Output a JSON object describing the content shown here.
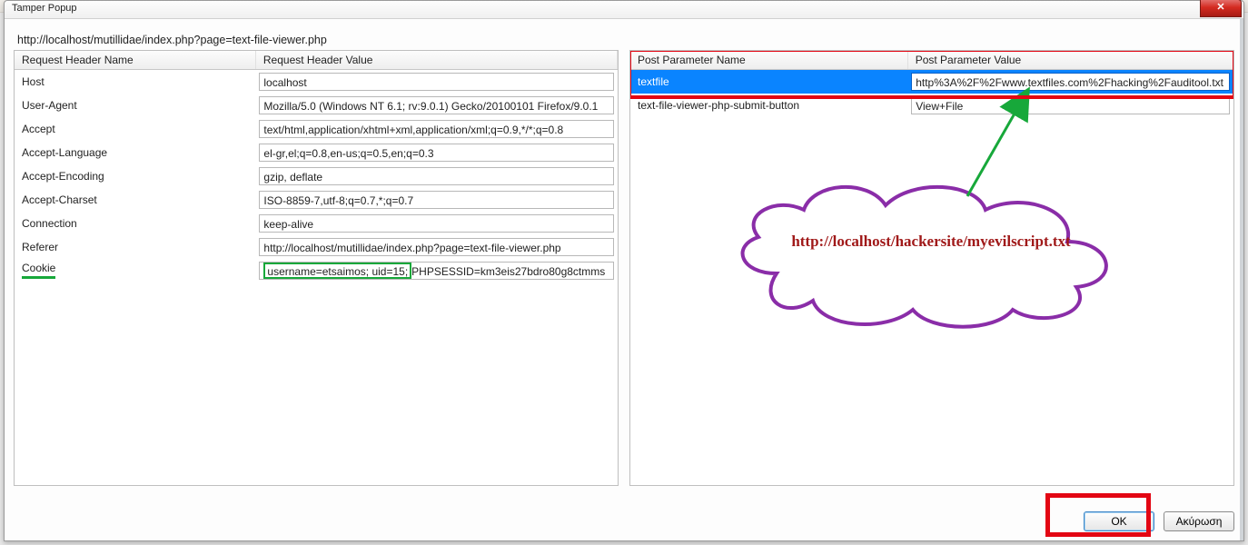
{
  "window": {
    "title": "Tamper Popup",
    "close_label": "✕"
  },
  "url": "http://localhost/mutillidae/index.php?page=text-file-viewer.php",
  "headers_table": {
    "col_name": "Request Header Name",
    "col_value": "Request Header Value",
    "rows": [
      {
        "name": "Host",
        "value": "localhost"
      },
      {
        "name": "User-Agent",
        "value": "Mozilla/5.0 (Windows NT 6.1; rv:9.0.1) Gecko/20100101 Firefox/9.0.1"
      },
      {
        "name": "Accept",
        "value": "text/html,application/xhtml+xml,application/xml;q=0.9,*/*;q=0.8"
      },
      {
        "name": "Accept-Language",
        "value": "el-gr,el;q=0.8,en-us;q=0.5,en;q=0.3"
      },
      {
        "name": "Accept-Encoding",
        "value": "gzip, deflate"
      },
      {
        "name": "Accept-Charset",
        "value": "ISO-8859-7,utf-8;q=0.7,*;q=0.7"
      },
      {
        "name": "Connection",
        "value": "keep-alive"
      },
      {
        "name": "Referer",
        "value": "http://localhost/mutillidae/index.php?page=text-file-viewer.php"
      }
    ],
    "cookie_row": {
      "name": "Cookie",
      "value_highlighted": "username=etsaimos; uid=15;",
      "value_rest": " PHPSESSID=km3eis27bdro80g8ctmms"
    }
  },
  "post_table": {
    "col_name": "Post Parameter Name",
    "col_value": "Post Parameter Value",
    "rows": [
      {
        "name": "textfile",
        "value": "http%3A%2F%2Fwww.textfiles.com%2Fhacking%2Fauditool.txt",
        "selected": true
      },
      {
        "name": "text-file-viewer-php-submit-button",
        "value": "View+File",
        "selected": false
      }
    ]
  },
  "annotation": {
    "cloud_text": "http://localhost/hackersite/myevilscript.txt"
  },
  "buttons": {
    "ok": "OK",
    "cancel": "Ακύρωση"
  },
  "colors": {
    "red_highlight": "#e30613",
    "green_highlight": "#17a83a",
    "purple_cloud": "#8a2da8",
    "green_arrow": "#17a83a",
    "selection_blue": "#0a84ff",
    "annotation_text": "#a01919"
  }
}
